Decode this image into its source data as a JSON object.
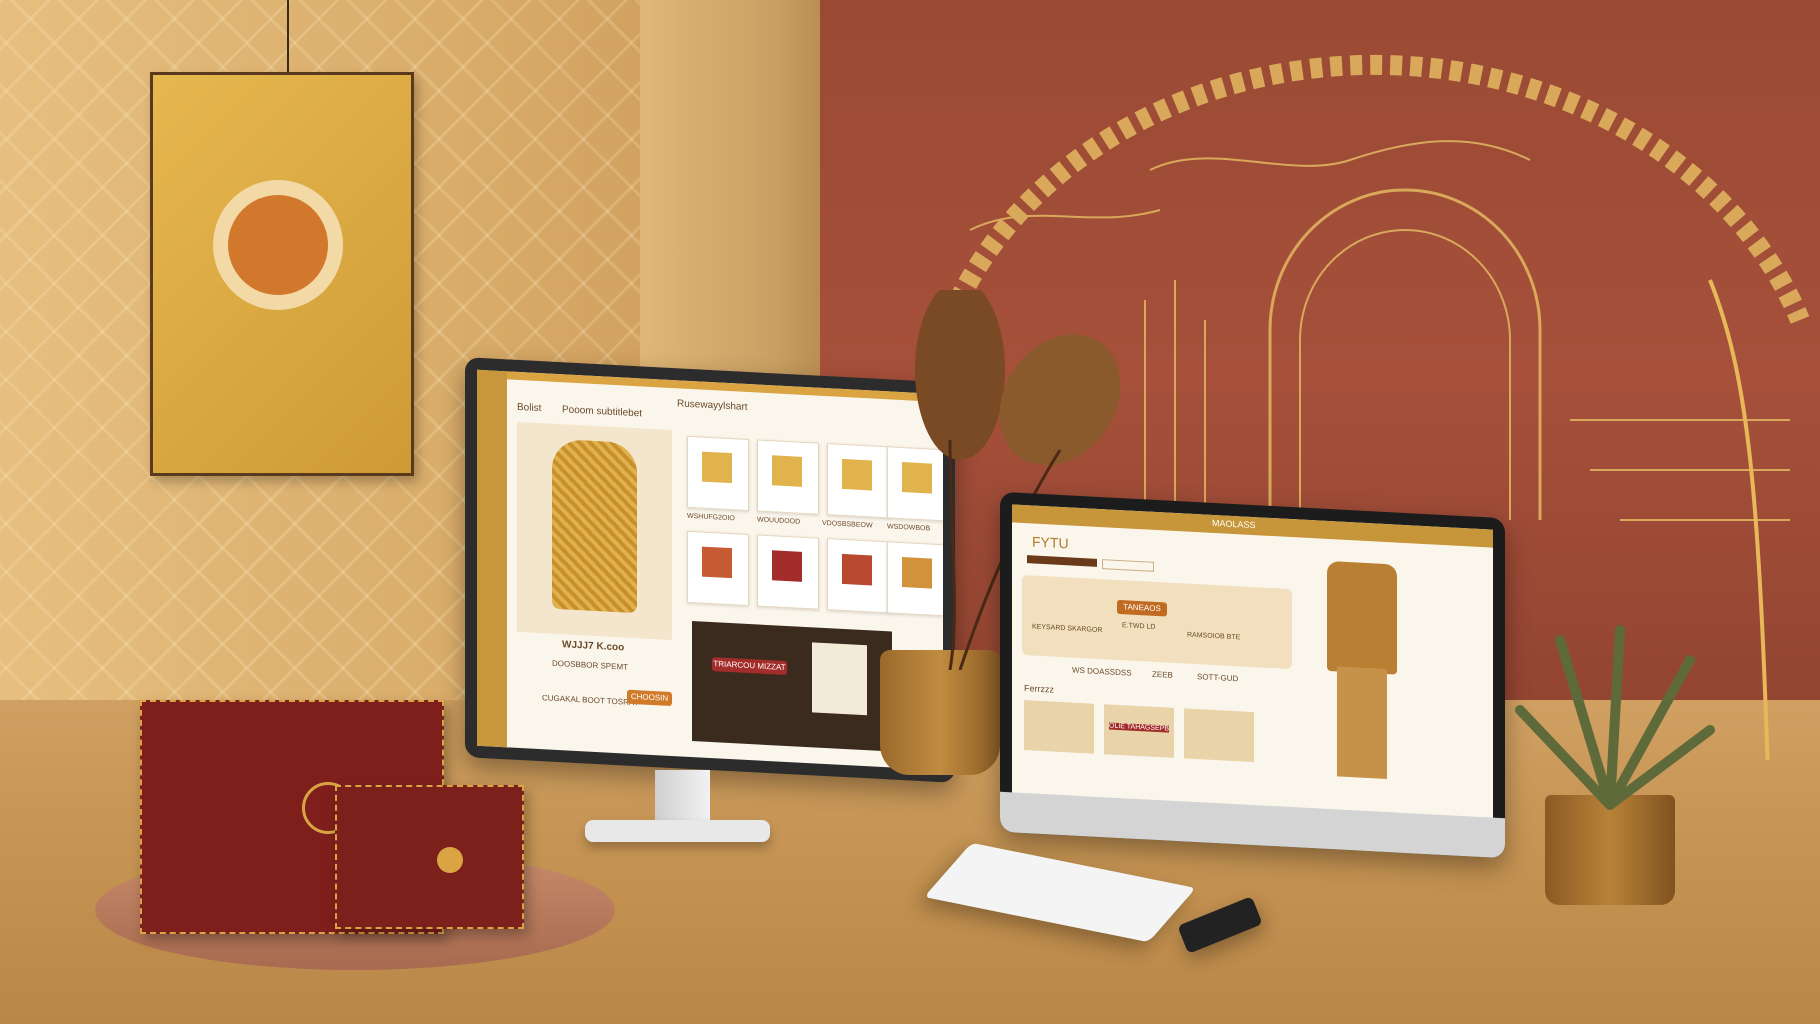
{
  "monitor_left": {
    "nav": [
      "Bolist",
      "Pooom subtitlebet"
    ],
    "header_title": "Rusewayylshart",
    "product_price": "WJJJ7 K.coo",
    "product_caption": "DOOSBBOR SPEMT",
    "cta_caption": "CUGAKAL BOOT TOSRAY",
    "cta_button": "CHOOSIN",
    "grid_labels": [
      "WSHUFG2OIO",
      "WOUUDOOD",
      "VDOSBSBEOW",
      "WSDOWBOB"
    ],
    "promo_banner": "TRIARCOU MIZZAT"
  },
  "monitor_right": {
    "logo": "FYTU",
    "header_title": "MAOLASS",
    "hero_button": "TANEAOS",
    "hero_price": "E.TWD LD",
    "hero_left_label": "KEYSARD SKARGOR",
    "hero_right_label": "RAMSOIOB BTE",
    "stats": [
      "WS DOASSDSS",
      "ZEEB",
      "SOTT-GUD"
    ],
    "section_title": "Ferrzzz",
    "card_label": "OLIE TAHAGSEPB"
  },
  "colors": {
    "gold": "#d9a441",
    "burgundy": "#7e1f1c",
    "terracotta": "#a6503a"
  }
}
